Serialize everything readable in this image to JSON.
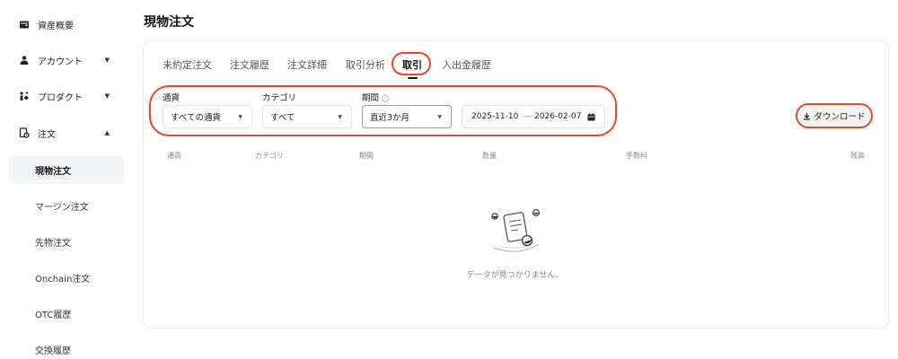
{
  "sidebar": {
    "items": [
      {
        "label": "資産概要",
        "icon": "wallet-icon"
      },
      {
        "label": "アカウント",
        "icon": "user-icon",
        "caret": "▼"
      },
      {
        "label": "プロダクト",
        "icon": "product-icon",
        "caret": "▼"
      },
      {
        "label": "注文",
        "icon": "order-icon",
        "caret": "▲"
      }
    ],
    "sub_items": [
      {
        "label": "現物注文",
        "active": true
      },
      {
        "label": "マージン注文"
      },
      {
        "label": "先物注文"
      },
      {
        "label": "Onchain注文"
      },
      {
        "label": "OTC履歴"
      },
      {
        "label": "交換履歴"
      }
    ]
  },
  "page": {
    "title": "現物注文"
  },
  "tabs": [
    {
      "label": "未約定注文"
    },
    {
      "label": "注文履歴"
    },
    {
      "label": "注文詳細"
    },
    {
      "label": "取引分析"
    },
    {
      "label": "取引",
      "active": true
    },
    {
      "label": "入出金履歴"
    }
  ],
  "filters": {
    "currency": {
      "label": "通貨",
      "value": "すべての通貨"
    },
    "category": {
      "label": "カテゴリ",
      "value": "すべて"
    },
    "period": {
      "label": "期間",
      "value": "直近3か月",
      "info": "i"
    },
    "date_from": "2025-11-10",
    "date_sep": "—",
    "date_to": "2026-02-07"
  },
  "download": {
    "label": "ダウンロード"
  },
  "table": {
    "headers": [
      "通貨",
      "カテゴリ",
      "期間",
      "数量",
      "手数料",
      "残高"
    ]
  },
  "empty": {
    "text": "データが見つかりません。"
  },
  "colors": {
    "highlight": "#e8472a",
    "active_bg": "#f3f4f6"
  }
}
